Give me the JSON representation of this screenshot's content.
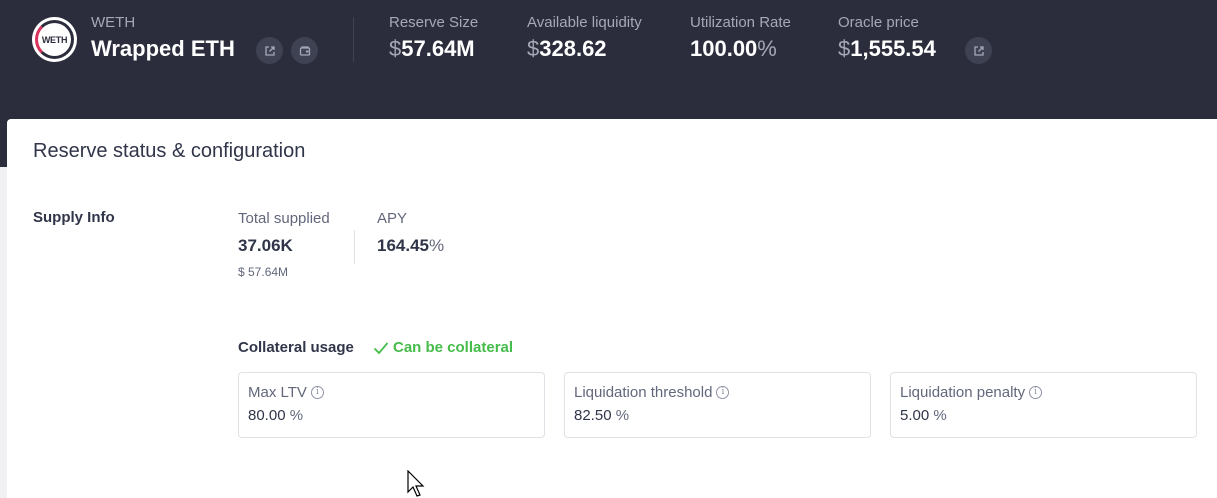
{
  "header": {
    "logo_text": "WETH",
    "symbol": "WETH",
    "name": "Wrapped ETH",
    "stats": [
      {
        "label": "Reserve Size",
        "prefix": "$",
        "value": "57.64M",
        "suffix": ""
      },
      {
        "label": "Available liquidity",
        "prefix": "$",
        "value": "328.62",
        "suffix": ""
      },
      {
        "label": "Utilization Rate",
        "prefix": "",
        "value": "100.00",
        "suffix": "%"
      },
      {
        "label": "Oracle price",
        "prefix": "$",
        "value": "1,555.54",
        "suffix": ""
      }
    ]
  },
  "card": {
    "title": "Reserve status & configuration",
    "supply": {
      "section_label": "Supply Info",
      "total_label": "Total supplied",
      "total_value": "37.06K",
      "total_usd": "$ 57.64M",
      "apy_label": "APY",
      "apy_value": "164.45",
      "apy_suffix": "%"
    },
    "collateral": {
      "label": "Collateral usage",
      "status": "Can be collateral",
      "status_color": "#46bc4b",
      "boxes": [
        {
          "label": "Max LTV",
          "value": "80.00",
          "suffix": "%"
        },
        {
          "label": "Liquidation threshold",
          "value": "82.50",
          "suffix": "%"
        },
        {
          "label": "Liquidation penalty",
          "value": "5.00",
          "suffix": "%"
        }
      ]
    }
  },
  "colors": {
    "header_bg": "#2b2d3c",
    "text_primary": "#303549",
    "text_secondary": "#62677b"
  }
}
